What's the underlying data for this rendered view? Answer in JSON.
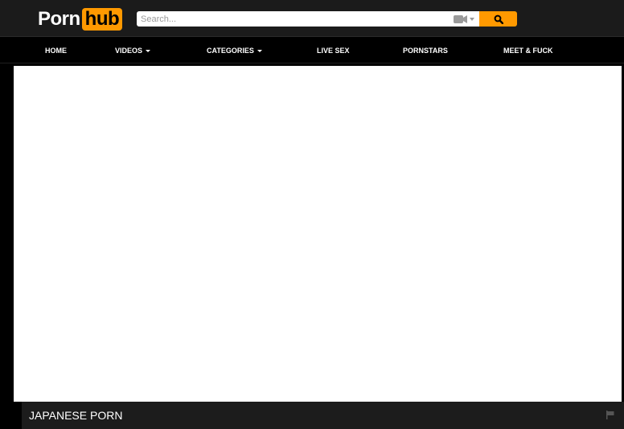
{
  "header": {
    "logo": {
      "part1": "Porn",
      "part2": "hub"
    },
    "search": {
      "placeholder": "Search..."
    },
    "video_filter_icon": "video-camera-icon",
    "search_button_icon": "magnifier-icon"
  },
  "nav": {
    "items": [
      {
        "label": "HOME",
        "has_dropdown": false
      },
      {
        "label": "VIDEOS",
        "has_dropdown": true
      },
      {
        "label": "CATEGORIES",
        "has_dropdown": true
      },
      {
        "label": "LIVE SEX",
        "has_dropdown": false
      },
      {
        "label": "PORNSTARS",
        "has_dropdown": false
      },
      {
        "label": "MEET & FUCK",
        "has_dropdown": false
      }
    ]
  },
  "video": {
    "title": "JAPANESE PORN",
    "flag_icon": "flag-icon"
  },
  "colors": {
    "accent": "#ff9900",
    "header_bg": "#1b1b1b",
    "nav_bg": "#000000",
    "page_bg": "#000000",
    "player_bg": "#ffffff",
    "title_bar_bg": "#1c1c1c"
  }
}
